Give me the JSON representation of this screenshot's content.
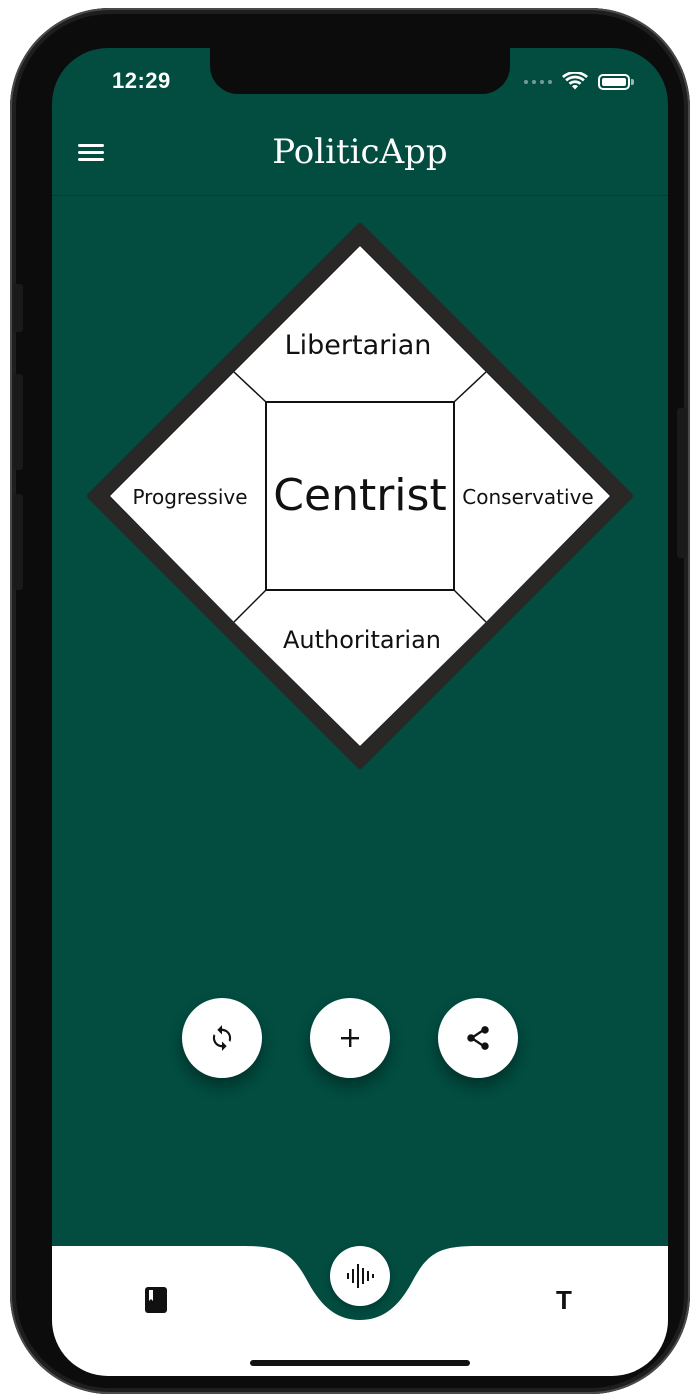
{
  "status_bar": {
    "time": "12:29"
  },
  "header": {
    "title": "PoliticApp",
    "menu_icon": "hamburger-menu-icon"
  },
  "compass": {
    "top_label": "Libertarian",
    "left_label": "Progressive",
    "center_label": "Centrist",
    "right_label": "Conservative",
    "bottom_label": "Authoritarian"
  },
  "actions": [
    {
      "name": "refresh",
      "icon": "refresh-icon"
    },
    {
      "name": "add",
      "icon": "plus-icon"
    },
    {
      "name": "share",
      "icon": "share-icon"
    }
  ],
  "bottom_nav": {
    "left_icon": "book-icon",
    "center_icon": "audio-waveform-icon",
    "right_icon": "text-icon",
    "right_glyph": "T"
  },
  "colors": {
    "primary": "#024c40",
    "surface": "#ffffff",
    "frame": "#111111"
  }
}
